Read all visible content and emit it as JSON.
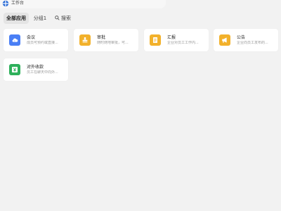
{
  "window": {
    "title": "工作台"
  },
  "tabs": [
    {
      "label": "全部应用",
      "active": true
    },
    {
      "label": "分组1",
      "active": false
    }
  ],
  "search": {
    "label": "搜索"
  },
  "apps": [
    {
      "title": "会议",
      "desc": "成员可预约或直接...",
      "icon": "cloud-icon",
      "color": "#4a7ff5"
    },
    {
      "title": "审批",
      "desc": "随时随地审批，可...",
      "icon": "stamp-icon",
      "color": "#f2b12b"
    },
    {
      "title": "汇报",
      "desc": "企业对员工工作内...",
      "icon": "document-icon",
      "color": "#f2b12b"
    },
    {
      "title": "公告",
      "desc": "企业向员工发布的...",
      "icon": "megaphone-icon",
      "color": "#f2b12b"
    },
    {
      "title": "对外收款",
      "desc": "员工在聊天中向外...",
      "icon": "yen-icon",
      "color": "#2eb05b"
    }
  ]
}
